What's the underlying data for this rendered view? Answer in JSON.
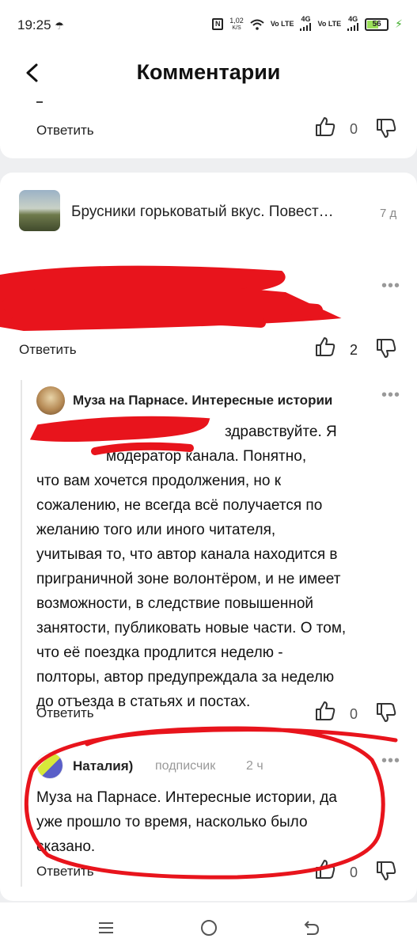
{
  "status_bar": {
    "time": "19:25",
    "net_speed_value": "1,02",
    "net_speed_unit": "K/S",
    "sim1": "Vo LTE",
    "sim2": "Vo LTE",
    "net1": "4G",
    "net2": "4G",
    "battery": "56"
  },
  "header": {
    "title": "Комментарии"
  },
  "top_comment": {
    "reply_label": "Ответить",
    "likes": "0"
  },
  "article": {
    "title": "Брусники горьковатый вкус. Повест…",
    "age": "7 д"
  },
  "comment_redacted": {
    "reply_label": "Ответить",
    "likes": "2"
  },
  "comment_muza": {
    "author": "Муза на Парнасе. Интересные истории",
    "text_lines": [
      "здравствуйте. Я",
      "модератор канала. Понятно,",
      "что вам хочется продолжения, но к",
      "сожалению, не всегда всё получается по",
      "желанию того или иного читателя,",
      "учитывая то, что автор канала находится в",
      "приграничной зоне волонтёром, и не имеет",
      "возможности, в следствие повышенной",
      "занятости, публиковать новые части. О том,",
      "что её поездка продлится неделю -",
      "полторы, автор предупреждала за неделю",
      "до отъезда в статьях и постах."
    ],
    "reply_label": "Ответить",
    "likes": "0"
  },
  "comment_natalia": {
    "author": "Наталия)",
    "role": "подписчик",
    "age": "2 ч",
    "text_lines": [
      "Муза на Парнасе. Интересные истории, да",
      "уже прошло то время, насколько было",
      "сказано."
    ],
    "reply_label": "Ответить",
    "likes": "0"
  },
  "colors": {
    "annotation_red": "#e8141c",
    "background_gap": "#eeeff1",
    "battery_fill": "#9be05a"
  },
  "icons": [
    "back-arrow-icon",
    "thumb-up-icon",
    "thumb-down-icon",
    "more-dots-icon",
    "menu-icon",
    "home-circle-icon",
    "back-nav-icon"
  ]
}
